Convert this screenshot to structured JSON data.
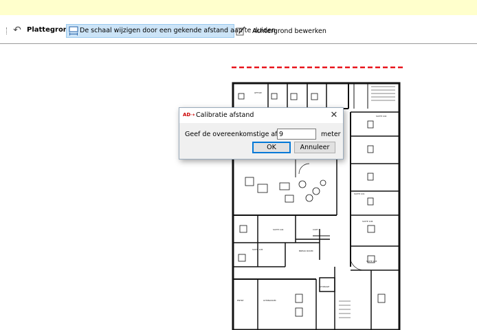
{
  "toolbar": {
    "plan_label": "Plattegrond:",
    "scale_button_label": "De schaal wijzigen door een gekende afstand aan te duiden",
    "edit_background_label": "Achtergrond bewerken"
  },
  "floorplan": {
    "room_labels": [
      "OFFICE",
      "STORAGE",
      "COPY",
      "SUITE 104",
      "SUITE 105",
      "SUITE 102",
      "SUITE 101",
      "BREAK ROOM",
      "GYMNASIUM",
      "SUITE 106",
      "SUITE 103",
      "ENTRY"
    ],
    "measure_line_color": "#e8141b"
  },
  "dialog": {
    "title": "Calibratie afstand",
    "prompt": "Geef de overeenkomstige afstand:",
    "input_value": "9",
    "unit": "meter",
    "ok_label": "OK",
    "cancel_label": "Annuleer"
  },
  "colors": {
    "notice_bar": "#ffffcc",
    "active_button": "#cce4f7",
    "dialog_bg": "#f0f0f0"
  }
}
